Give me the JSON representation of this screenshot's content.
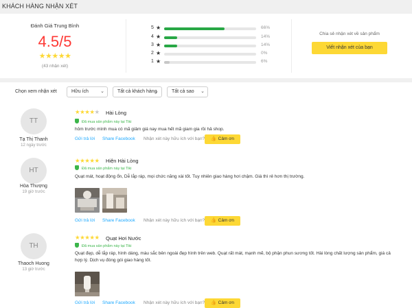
{
  "section_title": "KHÁCH HÀNG NHẬN XÉT",
  "summary": {
    "avg_label": "Đánh Giá Trung Bình",
    "avg_score": "4.5/5",
    "avg_stars": 4.5,
    "count_text": "(43 nhận xét)",
    "distribution": [
      {
        "stars": "5",
        "percent_value": 66,
        "percent": "66%"
      },
      {
        "stars": "4",
        "percent_value": 14,
        "percent": "14%"
      },
      {
        "stars": "3",
        "percent_value": 14,
        "percent": "14%"
      },
      {
        "stars": "2",
        "percent_value": 0,
        "percent": "0%"
      },
      {
        "stars": "1",
        "percent_value": 6,
        "percent": "6%"
      }
    ],
    "share_label": "Chia sẻ nhận xét về sản phẩm",
    "write_button": "Viết nhận xét của bạn"
  },
  "filters": {
    "label": "Chọn xem nhận xét",
    "options": [
      "Hữu ích",
      "Tất cả khách hàng",
      "Tất cả sao"
    ]
  },
  "reviews": [
    {
      "initials": "TT",
      "name": "Tạ Thị Thanh",
      "time": "12 ngày trước",
      "rating": 4,
      "title": "Hài Lòng",
      "verified": "Đã mua sản phẩm này tại Tiki",
      "text": "hôm trước mình mua có mã giảm giá nay mua hết mã giam gia rồi hả shop."
    },
    {
      "initials": "HT",
      "name": "Hòa Thượng",
      "time": "19 giờ trước",
      "rating": 5,
      "title": "Hiện Hài Lòng",
      "verified": "Đã mua sản phẩm này tại Tiki",
      "text": "Quạt mát, hoạt động ổn, Dễ lắp ráp, mọi chức năng xài tốt. Tuy nhiên giao hàng hơi chậm. Giá thì rẻ hơn thị trường."
    },
    {
      "initials": "TH",
      "name": "Thaoch Huong",
      "time": "13 giờ trước",
      "rating": 5,
      "title": "Quạt Hơi Nước",
      "verified": "Đã mua sản phẩm này tại Tiki",
      "text": "Quạt đẹp, dễ lắp ráp, hình dáng, màu sắc bên ngoài đẹp hình trên web. Quạt rất mát, mạnh mẽ, bộ phận phun sương tốt. Hài lòng chất lượng sản phẩm, giá cả hợp lý. Dịch vụ đóng gói giao hàng tốt."
    }
  ],
  "actions": {
    "reply": "Gửi trả lời",
    "share": "Share Facebook",
    "question": "Nhận xét này hữu ích với bạn?",
    "thanks": "Cảm ơn"
  }
}
